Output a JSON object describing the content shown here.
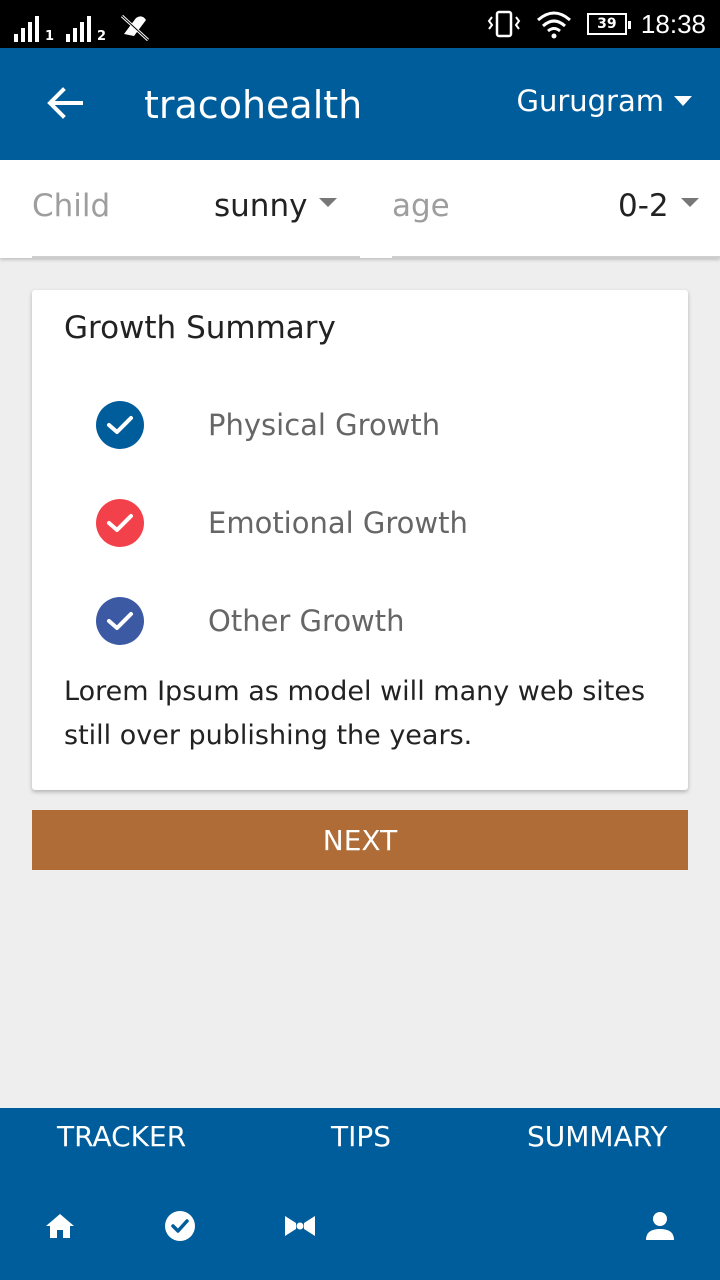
{
  "status_bar": {
    "sim1_label": "1",
    "sim2_label": "2",
    "battery": "39",
    "time": "18:38"
  },
  "app_bar": {
    "title": "tracohealth",
    "city": "Gurugram"
  },
  "filters": {
    "child_label": "Child",
    "child_value": "sunny",
    "age_label": "age",
    "age_value": "0-2"
  },
  "summary": {
    "title": "Growth Summary",
    "items": [
      {
        "label": "Physical Growth",
        "color": "#005d9b"
      },
      {
        "label": "Emotional Growth",
        "color": "#f2414a"
      },
      {
        "label": "Other Growth",
        "color": "#3c5aa4"
      }
    ],
    "description": "Lorem Ipsum as model will many web sites still over publishing the years."
  },
  "next_button": {
    "label": "NEXT"
  },
  "bottom_nav": {
    "tabs": [
      "TRACKER",
      "TIPS",
      "SUMMARY"
    ],
    "icons": [
      "home-icon",
      "check-circle-icon",
      "bowtie-icon",
      "person-icon"
    ]
  },
  "colors": {
    "primary": "#005d9b",
    "accent_button": "#b06c36",
    "background": "#eeeeee"
  }
}
